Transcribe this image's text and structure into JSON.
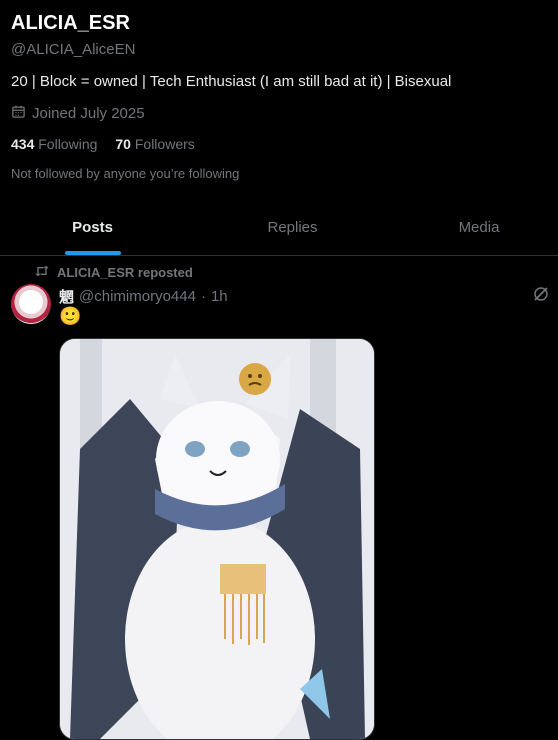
{
  "profile": {
    "display_name": "ALICIA_ESR",
    "handle": "@ALICIA_AliceEN",
    "bio": "20 | Block = owned | Tech Enthusiast (I am still bad at it) | Bisexual",
    "joined": "Joined July 2025",
    "following_count": "434",
    "following_label": "Following",
    "followers_count": "70",
    "followers_label": "Followers",
    "not_followed": "Not followed by anyone you’re following"
  },
  "tabs": [
    {
      "label": "Posts",
      "active": true
    },
    {
      "label": "Replies",
      "active": false
    },
    {
      "label": "Media",
      "active": false
    }
  ],
  "post": {
    "repost_label": "ALICIA_ESR reposted",
    "author_name": "魍",
    "author_handle": "@chimimoryo444",
    "separator": "·",
    "time": "1h",
    "text": "🙂"
  },
  "colors": {
    "accent": "#1d9bf0",
    "muted": "#71767b",
    "background": "#000000",
    "divider": "#2f3336"
  },
  "icons": {
    "calendar": "calendar-icon",
    "repost": "repost-icon",
    "grok": "grok-icon"
  }
}
